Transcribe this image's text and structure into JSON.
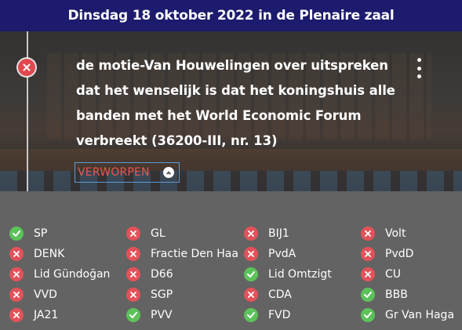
{
  "header": {
    "title": "Dinsdag 18 oktober 2022 in de Plenaire zaal"
  },
  "motion": {
    "lines": [
      "de motie-Van Houwelingen over uitspreken",
      "dat het wenselijk is dat het koningshuis alle",
      "banden met het World Economic Forum",
      "verbreekt (36200-III, nr. 13)"
    ],
    "result": "VERWORPEN",
    "status_icon": "close-icon",
    "menu_icon": "more-vertical-icon",
    "toggle_icon": "chevron-up-icon"
  },
  "colors": {
    "header": "#1c1b6e",
    "yes": "#5cc25a",
    "no": "#e2525a",
    "result": "#e8584f",
    "focus": "#5b9bd5"
  },
  "votes": {
    "columns": [
      [
        {
          "name": "SP",
          "vote": "voor"
        },
        {
          "name": "DENK",
          "vote": "tegen"
        },
        {
          "name": "Lid Gündoğan",
          "vote": "tegen"
        },
        {
          "name": "VVD",
          "vote": "tegen"
        },
        {
          "name": "JA21",
          "vote": "tegen"
        }
      ],
      [
        {
          "name": "GL",
          "vote": "tegen"
        },
        {
          "name": "Fractie Den Haan",
          "vote": "tegen"
        },
        {
          "name": "D66",
          "vote": "tegen"
        },
        {
          "name": "SGP",
          "vote": "tegen"
        },
        {
          "name": "PVV",
          "vote": "voor"
        }
      ],
      [
        {
          "name": "BIJ1",
          "vote": "tegen"
        },
        {
          "name": "PvdA",
          "vote": "tegen"
        },
        {
          "name": "Lid Omtzigt",
          "vote": "voor"
        },
        {
          "name": "CDA",
          "vote": "tegen"
        },
        {
          "name": "FVD",
          "vote": "voor"
        }
      ],
      [
        {
          "name": "Volt",
          "vote": "tegen"
        },
        {
          "name": "PvdD",
          "vote": "tegen"
        },
        {
          "name": "CU",
          "vote": "tegen"
        },
        {
          "name": "BBB",
          "vote": "voor"
        },
        {
          "name": "Gr Van Haga",
          "vote": "voor"
        }
      ]
    ]
  }
}
